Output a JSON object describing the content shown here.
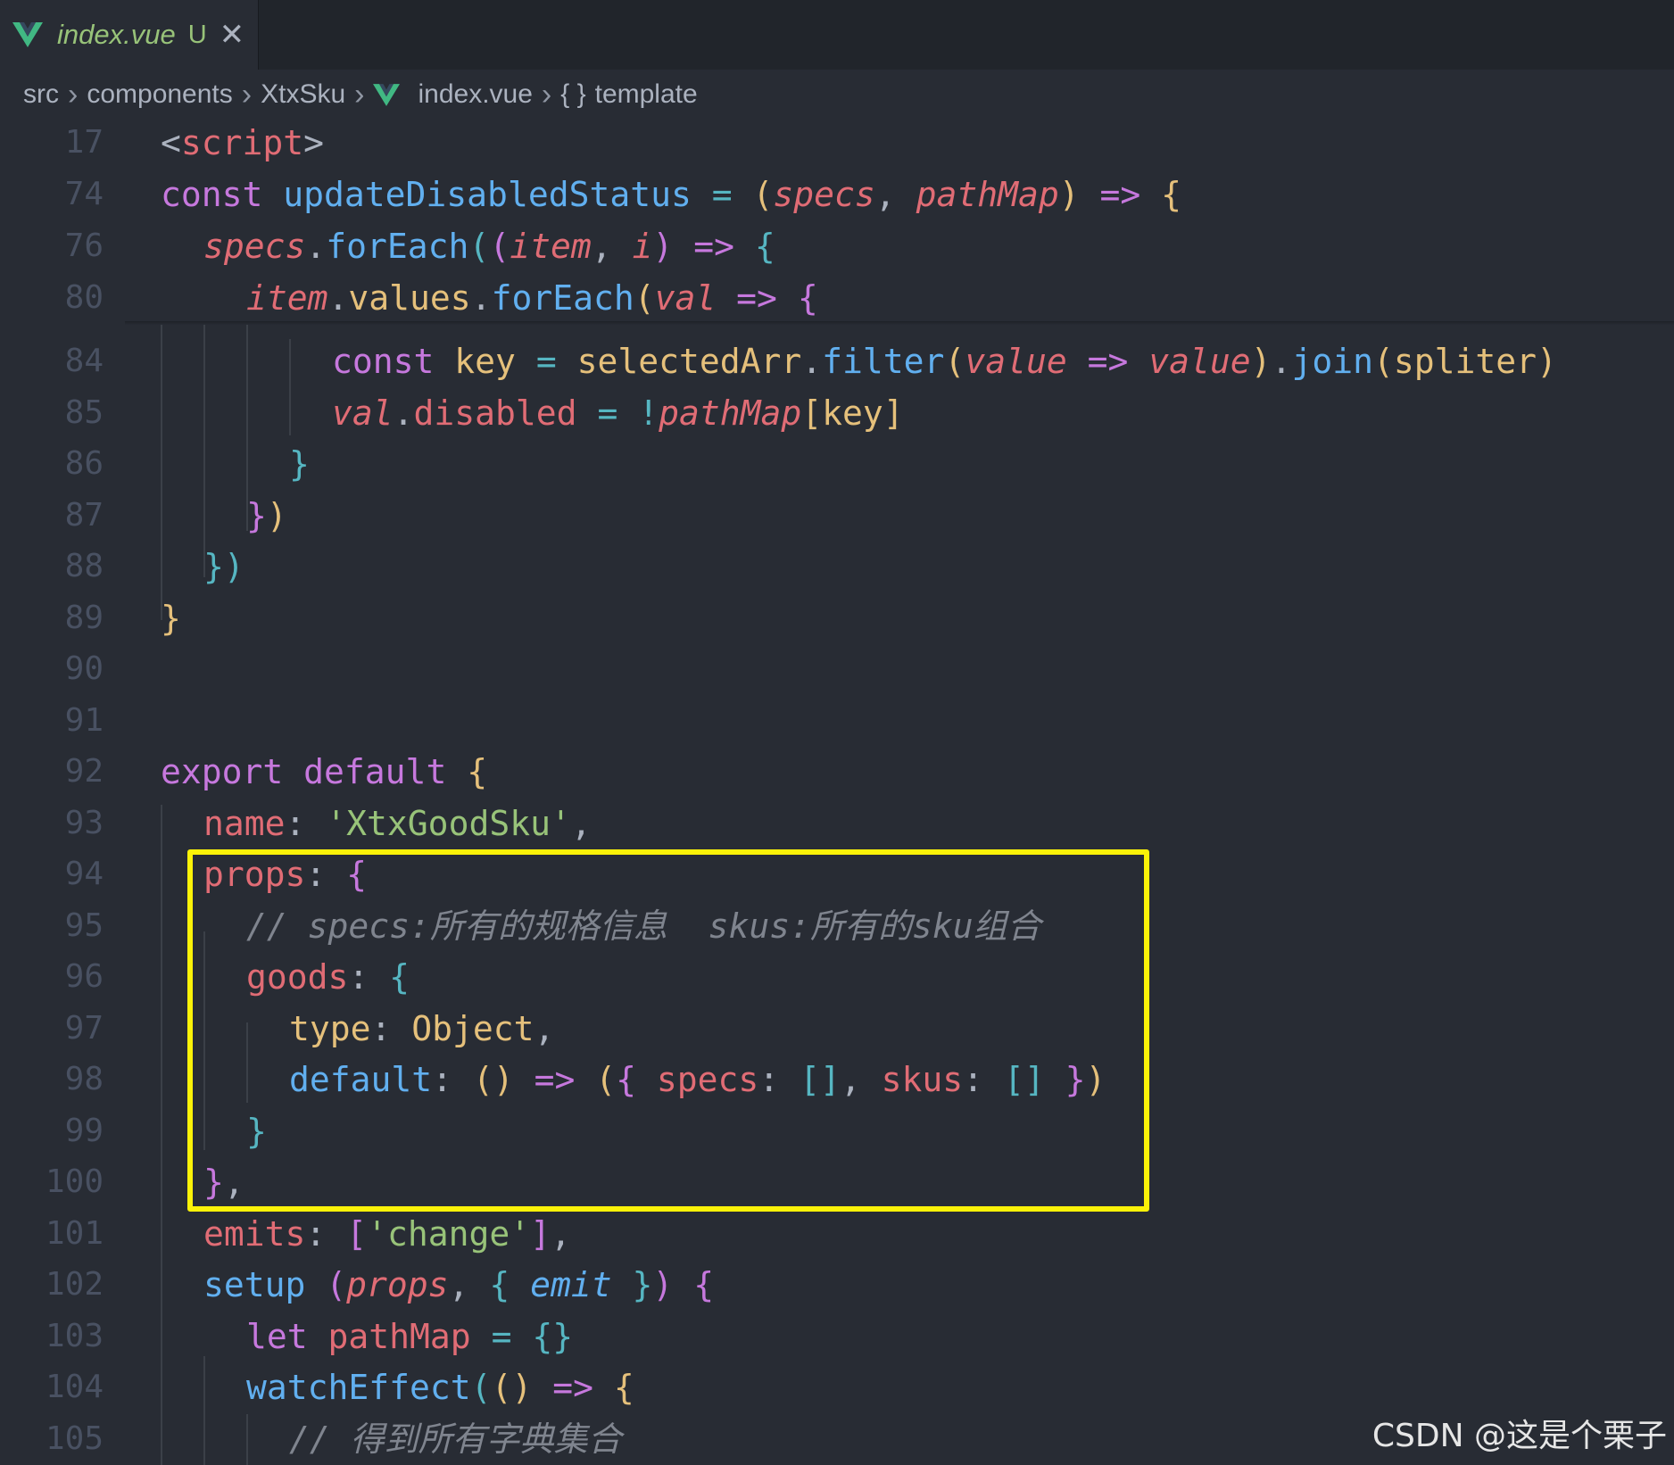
{
  "tab": {
    "filename": "index.vue",
    "status": "U",
    "close": "✕"
  },
  "breadcrumb": [
    "src",
    "components",
    "XtxSku",
    "index.vue",
    "template"
  ],
  "breadcrumb_braces": "{ }",
  "line_numbers": [
    "17",
    "74",
    "76",
    "80",
    "84",
    "85",
    "86",
    "87",
    "88",
    "89",
    "90",
    "91",
    "92",
    "93",
    "94",
    "95",
    "96",
    "97",
    "98",
    "99",
    "100",
    "101",
    "102",
    "103",
    "104",
    "105"
  ],
  "watermark": "CSDN @这是个栗子",
  "highlight_color": "#fbf208",
  "colors": {
    "background": "#282c34",
    "keyword": "#c678dd",
    "function": "#61afef",
    "variable": "#e06c75",
    "string": "#98c379",
    "class": "#e5c07b",
    "operator": "#56b6c2",
    "comment": "#7f848e"
  },
  "code": {
    "l17": {
      "open": "<",
      "tag": "script",
      "close": ">"
    },
    "l74": {
      "kw": "const",
      "fn": "updateDisabledStatus",
      "op": "=",
      "p_open": "(",
      "a1": "specs",
      "comma": ",",
      "a2": "pathMap",
      "p_close": ")",
      "arrow": "=>",
      "brace": "{"
    },
    "l76": {
      "obj": "specs",
      "dot": ".",
      "fn": "forEach",
      "p1": "(",
      "p2": "(",
      "a1": "item",
      "comma": ",",
      "a2": "i",
      "p3": ")",
      "arrow": "=>",
      "brace": "{"
    },
    "l80": {
      "obj": "item",
      "dot": ".",
      "prop": "values",
      "dot2": ".",
      "fn": "forEach",
      "p": "(",
      "a1": "val",
      "arrow": "=>",
      "brace": "{"
    },
    "l84": {
      "kw": "const",
      "name": "key",
      "op": "=",
      "obj": "selectedArr",
      "dot": ".",
      "fn": "filter",
      "p": "(",
      "a1": "value",
      "arrow": "=>",
      "a2": "value",
      "p2": ")",
      "dot2": ".",
      "fn2": "join",
      "p3": "(",
      "arg": "spliter",
      "p4": ")"
    },
    "l85": {
      "obj": "val",
      "dot": ".",
      "prop": "disabled",
      "op": "=",
      "not": "!",
      "obj2": "pathMap",
      "b1": "[",
      "key": "key",
      "b2": "]"
    },
    "l86": {
      "brace": "}"
    },
    "l87": {
      "brace": "}",
      "paren": ")"
    },
    "l88": {
      "brace": "}",
      "paren": ")"
    },
    "l89": {
      "brace": "}"
    },
    "l92": {
      "kw1": "export",
      "kw2": "default",
      "brace": "{"
    },
    "l93": {
      "key": "name",
      "colon": ":",
      "str": "'XtxGoodSku'",
      "comma": ","
    },
    "l94": {
      "key": "props",
      "colon": ":",
      "brace": "{"
    },
    "l95": {
      "comment": "// specs:所有的规格信息  skus:所有的sku组合"
    },
    "l96": {
      "key": "goods",
      "colon": ":",
      "brace": "{"
    },
    "l97": {
      "key": "type",
      "colon": ":",
      "cls": "Object",
      "comma": ","
    },
    "l98": {
      "key": "default",
      "colon": ":",
      "parens": "()",
      "arrow": "=>",
      "p_open": "(",
      "b_open": "{",
      "k1": "specs",
      "c1": ":",
      "arr1": "[]",
      "comma": ",",
      "k2": "skus",
      "c2": ":",
      "arr2": "[]",
      "b_close": "}",
      "p_close": ")"
    },
    "l99": {
      "brace": "}"
    },
    "l100": {
      "brace": "}",
      "comma": ","
    },
    "l101": {
      "key": "emits",
      "colon": ":",
      "b_open": "[",
      "str": "'change'",
      "b_close": "]",
      "comma": ","
    },
    "l102": {
      "fn": "setup",
      "p_open": "(",
      "a1": "props",
      "comma": ",",
      "b_open": "{",
      "a2": "emit",
      "b_close": "}",
      "p_close": ")",
      "brace": "{"
    },
    "l103": {
      "kw": "let",
      "name": "pathMap",
      "op": "=",
      "braces": "{}"
    },
    "l104": {
      "fn": "watchEffect",
      "p1": "(",
      "parens": "()",
      "arrow": "=>",
      "brace": "{"
    },
    "l105": {
      "comment": "// 得到所有字典集合"
    }
  }
}
